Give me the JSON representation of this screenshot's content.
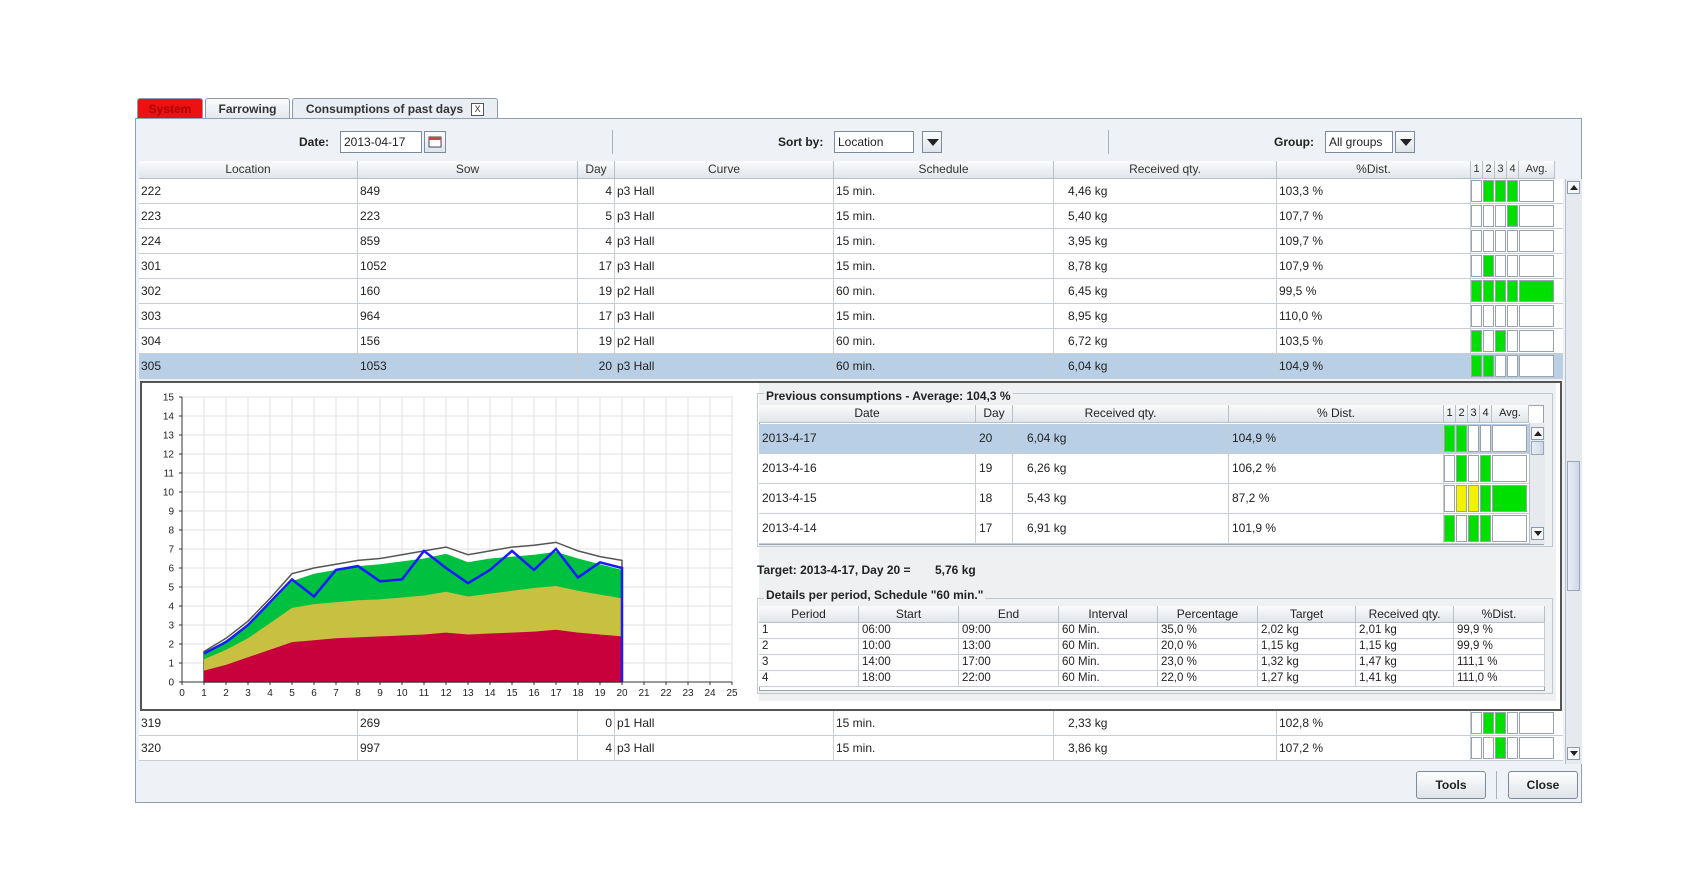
{
  "tabs": [
    {
      "label": "System"
    },
    {
      "label": "Farrowing"
    },
    {
      "label": "Consumptions of past days",
      "close": "X"
    }
  ],
  "toolbar": {
    "date_label": "Date:",
    "date_value": "2013-04-17",
    "sort_label": "Sort by:",
    "sort_value": "Location",
    "group_label": "Group:",
    "group_value": "All groups"
  },
  "main_table": {
    "columns": [
      "Location",
      "Sow",
      "Day",
      "Curve",
      "Schedule",
      "Received qty.",
      "%Dist.",
      "1",
      "2",
      "3",
      "4",
      "Avg."
    ],
    "rows": [
      {
        "location": "222",
        "sow": "849",
        "day": "4",
        "curve": "p3 Hall",
        "schedule": "15 min.",
        "received": "4,46 kg",
        "dist": "103,3 %",
        "bars": [
          "w",
          "g",
          "g",
          "g"
        ],
        "avg": "w"
      },
      {
        "location": "223",
        "sow": "223",
        "day": "5",
        "curve": "p3 Hall",
        "schedule": "15 min.",
        "received": "5,40 kg",
        "dist": "107,7 %",
        "bars": [
          "w",
          "w",
          "w",
          "g"
        ],
        "avg": "w"
      },
      {
        "location": "224",
        "sow": "859",
        "day": "4",
        "curve": "p3 Hall",
        "schedule": "15 min.",
        "received": "3,95 kg",
        "dist": "109,7 %",
        "bars": [
          "w",
          "w",
          "w",
          "w"
        ],
        "avg": "w"
      },
      {
        "location": "301",
        "sow": "1052",
        "day": "17",
        "curve": "p3 Hall",
        "schedule": "15 min.",
        "received": "8,78 kg",
        "dist": "107,9 %",
        "bars": [
          "w",
          "g",
          "w",
          "w"
        ],
        "avg": "w"
      },
      {
        "location": "302",
        "sow": "160",
        "day": "19",
        "curve": "p2 Hall",
        "schedule": "60 min.",
        "received": "6,45 kg",
        "dist": "99,5 %",
        "bars": [
          "g",
          "g",
          "g",
          "g"
        ],
        "avg": "g"
      },
      {
        "location": "303",
        "sow": "964",
        "day": "17",
        "curve": "p3 Hall",
        "schedule": "15 min.",
        "received": "8,95 kg",
        "dist": "110,0 %",
        "bars": [
          "w",
          "w",
          "w",
          "w"
        ],
        "avg": "w"
      },
      {
        "location": "304",
        "sow": "156",
        "day": "19",
        "curve": "p2 Hall",
        "schedule": "60 min.",
        "received": "6,72 kg",
        "dist": "103,5 %",
        "bars": [
          "g",
          "w",
          "g",
          "w"
        ],
        "avg": "w"
      },
      {
        "location": "305",
        "sow": "1053",
        "day": "20",
        "curve": "p3 Hall",
        "schedule": "60 min.",
        "received": "6,04 kg",
        "dist": "104,9 %",
        "bars": [
          "g",
          "g",
          "w",
          "w"
        ],
        "avg": "w",
        "selected": true
      },
      {
        "location": "319",
        "sow": "269",
        "day": "0",
        "curve": "p1 Hall",
        "schedule": "15 min.",
        "received": "2,33 kg",
        "dist": "102,8 %",
        "bars": [
          "w",
          "g",
          "g",
          "w"
        ],
        "avg": "w"
      },
      {
        "location": "320",
        "sow": "997",
        "day": "4",
        "curve": "p3 Hall",
        "schedule": "15 min.",
        "received": "3,86 kg",
        "dist": "107,2 %",
        "bars": [
          "w",
          "w",
          "g",
          "w"
        ],
        "avg": "w"
      }
    ]
  },
  "previous": {
    "title": "Previous consumptions - Average: 104,3 %",
    "columns": [
      "Date",
      "Day",
      "Received qty.",
      "% Dist.",
      "1",
      "2",
      "3",
      "4",
      "Avg."
    ],
    "rows": [
      {
        "date": "2013-4-17",
        "day": "20",
        "received": "6,04 kg",
        "dist": "104,9 %",
        "bars": [
          "g",
          "g",
          "w",
          "w"
        ],
        "avg": "w",
        "selected": true
      },
      {
        "date": "2013-4-16",
        "day": "19",
        "received": "6,26 kg",
        "dist": "106,2 %",
        "bars": [
          "w",
          "g",
          "w",
          "g"
        ],
        "avg": "w"
      },
      {
        "date": "2013-4-15",
        "day": "18",
        "received": "5,43 kg",
        "dist": "87,2 %",
        "bars": [
          "w",
          "y",
          "y",
          "g"
        ],
        "avg": "g"
      },
      {
        "date": "2013-4-14",
        "day": "17",
        "received": "6,91 kg",
        "dist": "101,9 %",
        "bars": [
          "g",
          "w",
          "g",
          "g"
        ],
        "avg": "w"
      }
    ]
  },
  "target": {
    "label": "Target: 2013-4-17, Day 20 =",
    "value": "5,76 kg"
  },
  "periods": {
    "title": "Details per period, Schedule \"60 min.\"",
    "columns": [
      "Period",
      "Start",
      "End",
      "Interval",
      "Percentage",
      "Target",
      "Received qty.",
      "%Dist."
    ],
    "rows": [
      {
        "period": "1",
        "start": "06:00",
        "end": "09:00",
        "interval": "60 Min.",
        "percentage": "35,0 %",
        "target": "2,02 kg",
        "received": "2,01 kg",
        "dist": "99,9 %"
      },
      {
        "period": "2",
        "start": "10:00",
        "end": "13:00",
        "interval": "60 Min.",
        "percentage": "20,0 %",
        "target": "1,15 kg",
        "received": "1,15 kg",
        "dist": "99,9 %"
      },
      {
        "period": "3",
        "start": "14:00",
        "end": "17:00",
        "interval": "60 Min.",
        "percentage": "23,0 %",
        "target": "1,32 kg",
        "received": "1,47 kg",
        "dist": "111,1 %"
      },
      {
        "period": "4",
        "start": "18:00",
        "end": "22:00",
        "interval": "60 Min.",
        "percentage": "22,0 %",
        "target": "1,27 kg",
        "received": "1,41 kg",
        "dist": "111,0 %"
      }
    ]
  },
  "buttons": {
    "tools": "Tools",
    "close": "Close"
  },
  "colors": {
    "green": "#00e000",
    "yellow": "#f2f200",
    "selection": "#b8cfe6",
    "system_tab": "#ee1111"
  },
  "chart_data": {
    "type": "area",
    "xlim": [
      0,
      25
    ],
    "ylim": [
      0,
      15
    ],
    "x_ticks": [
      0,
      1,
      2,
      3,
      4,
      5,
      6,
      7,
      8,
      9,
      10,
      11,
      12,
      13,
      14,
      15,
      16,
      17,
      18,
      19,
      20,
      21,
      22,
      23,
      24,
      25
    ],
    "y_ticks": [
      0,
      1,
      2,
      3,
      4,
      5,
      6,
      7,
      8,
      9,
      10,
      11,
      12,
      13,
      14,
      15
    ],
    "grid": true,
    "x": [
      1,
      2,
      3,
      4,
      5,
      6,
      7,
      8,
      9,
      10,
      11,
      12,
      13,
      14,
      15,
      16,
      17,
      18,
      19,
      20
    ],
    "series": [
      {
        "color": "#c8003c",
        "values": [
          0.6,
          0.9,
          1.3,
          1.7,
          2.1,
          2.2,
          2.3,
          2.35,
          2.4,
          2.45,
          2.5,
          2.6,
          2.5,
          2.55,
          2.6,
          2.65,
          2.75,
          2.6,
          2.5,
          2.4
        ]
      },
      {
        "color": "#c8c040",
        "values": [
          1.2,
          1.7,
          2.3,
          3.1,
          3.9,
          4.1,
          4.2,
          4.3,
          4.35,
          4.45,
          4.55,
          4.75,
          4.5,
          4.65,
          4.8,
          4.95,
          5.05,
          4.8,
          4.6,
          4.4
        ]
      },
      {
        "color": "#00c040",
        "values": [
          1.5,
          2.2,
          3.0,
          4.1,
          5.3,
          5.7,
          5.9,
          6.1,
          6.2,
          6.35,
          6.5,
          6.75,
          6.3,
          6.5,
          6.6,
          6.7,
          6.85,
          6.5,
          6.2,
          5.9
        ]
      },
      {
        "color": "#ffffff",
        "stroke": "#555555",
        "values": [
          1.6,
          2.3,
          3.2,
          4.4,
          5.7,
          6.0,
          6.2,
          6.4,
          6.5,
          6.7,
          6.9,
          7.1,
          6.7,
          6.9,
          7.1,
          7.2,
          7.35,
          6.9,
          6.6,
          6.4
        ]
      },
      {
        "color": "#1a1aff",
        "line": true,
        "values": [
          1.5,
          2.1,
          3.0,
          4.2,
          5.4,
          4.5,
          5.9,
          6.1,
          5.3,
          5.4,
          6.9,
          6.0,
          5.2,
          5.9,
          6.9,
          5.9,
          7.0,
          5.5,
          6.3,
          6.0
        ]
      }
    ]
  }
}
